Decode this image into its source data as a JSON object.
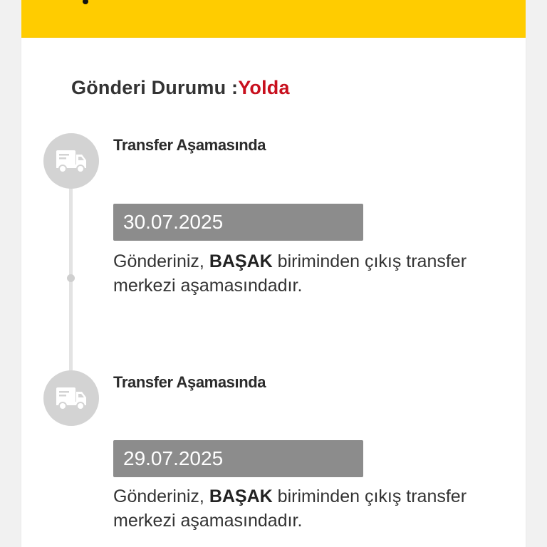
{
  "header": {
    "bar_color": "#ffcc00"
  },
  "shipment": {
    "status_label": "Gönderi Durumu :",
    "status_value": "Yolda",
    "status_value_color": "#c8101e"
  },
  "events": [
    {
      "icon": "truck-icon",
      "title": "Transfer Aşamasında",
      "date": "30.07.2025",
      "desc_prefix": "Gönderiniz,",
      "desc_unit": "BAŞAK",
      "desc_suffix": "biriminden çıkış transfer merkezi aşamasındadır."
    },
    {
      "icon": "truck-icon",
      "title": "Transfer Aşamasında",
      "date": "29.07.2025",
      "desc_prefix": "Gönderiniz,",
      "desc_unit": "BAŞAK",
      "desc_suffix": "biriminden çıkış transfer merkezi aşamasındadır."
    }
  ]
}
